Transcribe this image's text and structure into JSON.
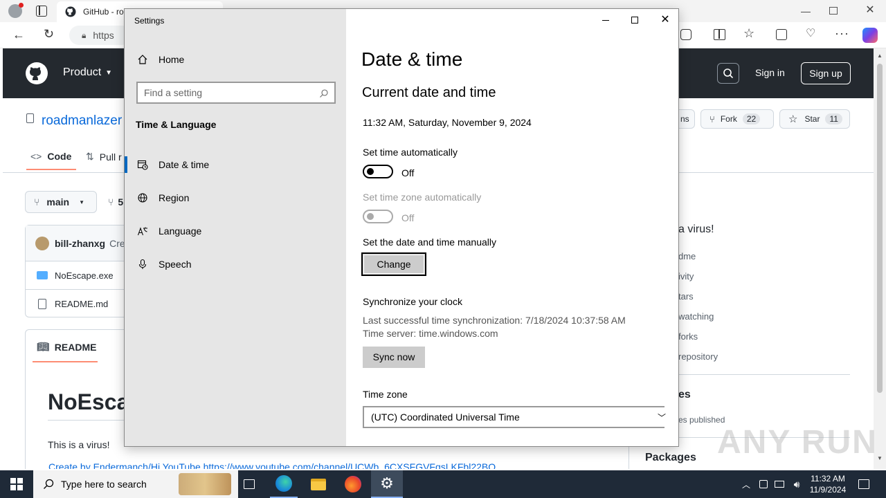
{
  "browser": {
    "tab_title": "GitHub - ro",
    "address": "https",
    "window_controls": [
      "minimize",
      "restore",
      "close"
    ]
  },
  "github": {
    "nav_product": "Product",
    "sign_in": "Sign in",
    "sign_up": "Sign up",
    "repo_owner": "roadmanlazer",
    "watch_label": "ns",
    "fork_label": "Fork",
    "fork_count": "22",
    "star_label": "Star",
    "star_count": "11",
    "tab_code": "Code",
    "tab_pull": "Pull r",
    "branch": "main",
    "branch_count": "5",
    "commit_author": "bill-zhanxg",
    "commit_msg": "Cre",
    "files": [
      "NoEscape.exe",
      "README.md"
    ],
    "readme_tab": "README",
    "readme_title": "NoEsca",
    "readme_text": "This is a virus!",
    "readme_partial": "Create by Endermanch/Hi YouTube https://www.youtube.com/channel/UCWb_6CXSFGVFgsLKFbl22BQ",
    "about_text": "a virus!",
    "about_links": [
      "dme",
      "ivity",
      "tars",
      "watching",
      "forks",
      "repository"
    ],
    "releases_heading": "es",
    "releases_sub": "es published",
    "packages_heading": "Packages"
  },
  "settings": {
    "window_title": "Settings",
    "home": "Home",
    "search_placeholder": "Find a setting",
    "section": "Time & Language",
    "nav": [
      {
        "label": "Date & time",
        "icon": "calendar-clock-icon"
      },
      {
        "label": "Region",
        "icon": "globe-icon"
      },
      {
        "label": "Language",
        "icon": "language-icon"
      },
      {
        "label": "Speech",
        "icon": "microphone-icon"
      }
    ],
    "page_title": "Date & time",
    "subtitle": "Current date and time",
    "current_datetime": "11:32 AM, Saturday, November 9, 2024",
    "auto_time_label": "Set time automatically",
    "auto_time_state": "Off",
    "auto_tz_label": "Set time zone automatically",
    "auto_tz_state": "Off",
    "manual_label": "Set the date and time manually",
    "change_button": "Change",
    "sync_heading": "Synchronize your clock",
    "sync_last": "Last successful time synchronization: 7/18/2024 10:37:58 AM",
    "sync_server": "Time server: time.windows.com",
    "sync_button": "Sync now",
    "timezone_label": "Time zone",
    "timezone_value": "(UTC) Coordinated Universal Time"
  },
  "taskbar": {
    "search_placeholder": "Type here to search",
    "time": "11:32 AM",
    "date": "11/9/2024"
  },
  "watermark": "ANY RUN"
}
